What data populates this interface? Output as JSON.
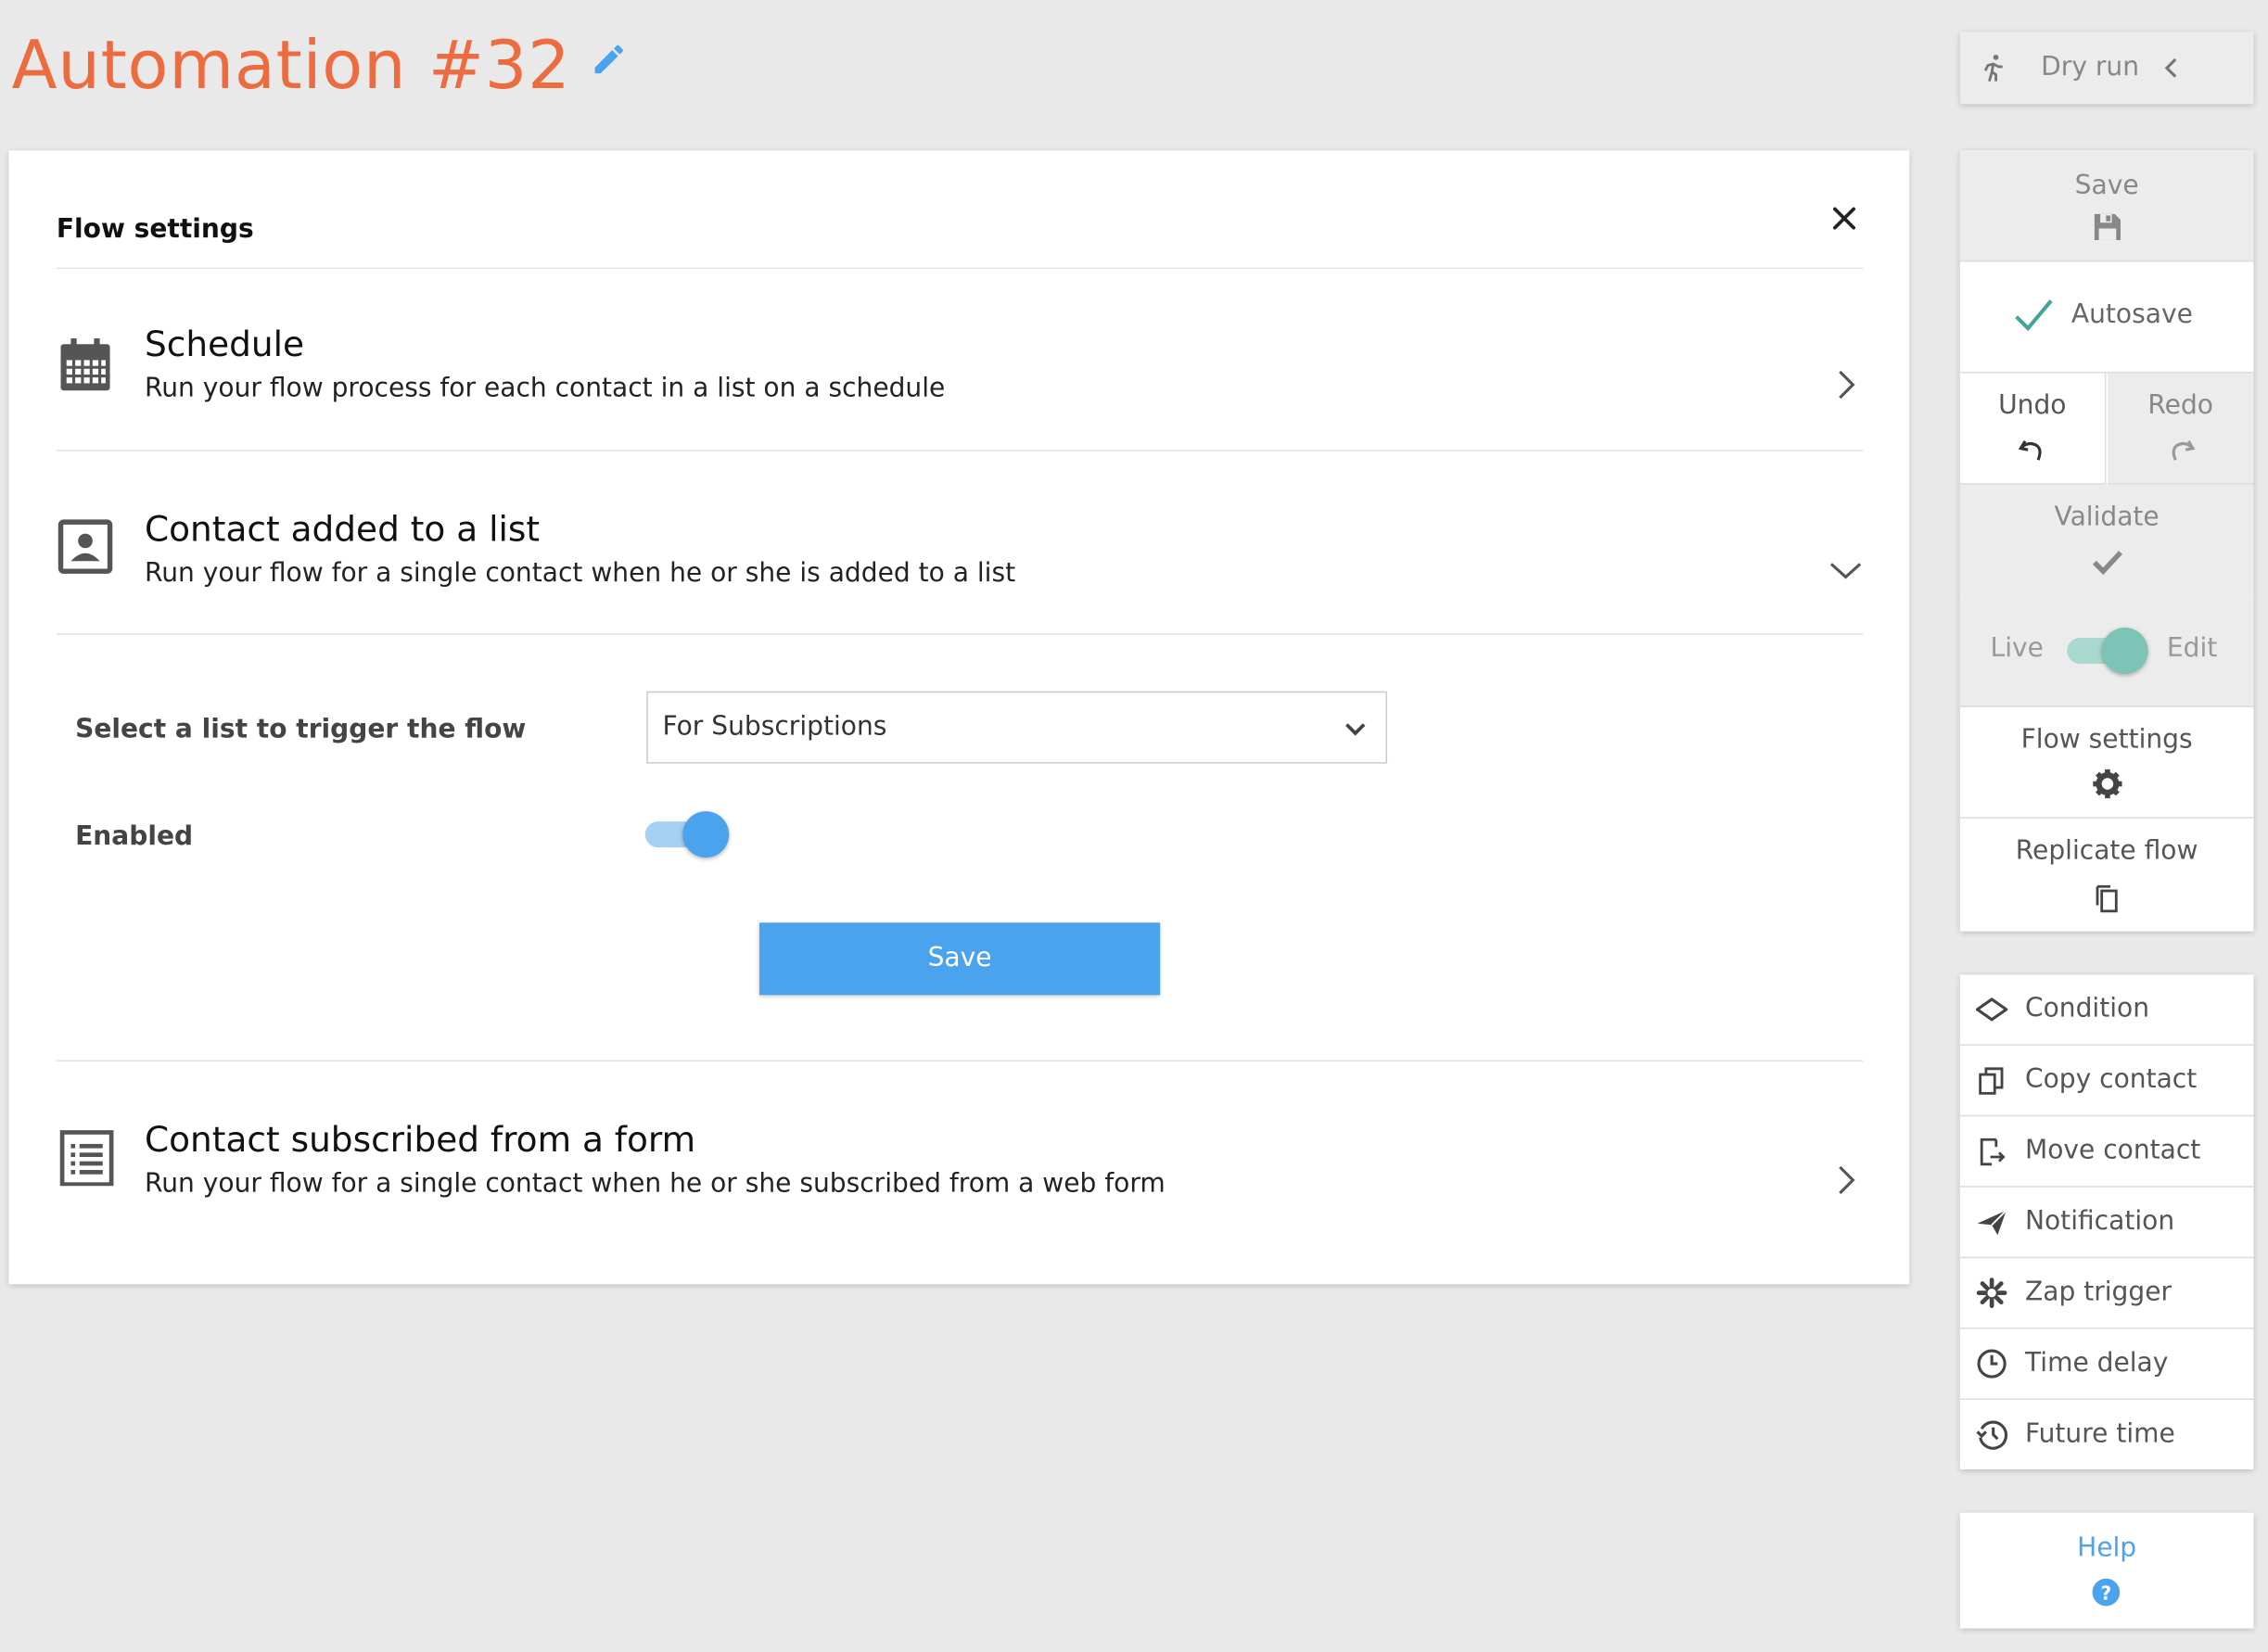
{
  "page": {
    "title": "Automation #32"
  },
  "modal": {
    "title": "Flow settings",
    "options": [
      {
        "title": "Schedule",
        "description": "Run your flow process for each contact in a list on a schedule",
        "icon": "calendar-icon",
        "state": "collapsed"
      },
      {
        "title": "Contact added to a list",
        "description": "Run your flow for a single contact when he or she is added to a list",
        "icon": "contact-card-icon",
        "state": "expanded"
      },
      {
        "title": "Contact subscribed from a form",
        "description": "Run your flow for a single contact when he or she subscribed from a web form",
        "icon": "form-icon",
        "state": "collapsed"
      }
    ],
    "list_field": {
      "label": "Select a list to trigger the flow",
      "value": "For Subscriptions"
    },
    "enabled_field": {
      "label": "Enabled",
      "checked": true
    },
    "save_label": "Save"
  },
  "toolbar": {
    "dry_run": "Dry run",
    "save": "Save",
    "autosave": "Autosave",
    "undo": "Undo",
    "redo": "Redo",
    "validate": "Validate",
    "live": "Live",
    "edit": "Edit",
    "flow_settings": "Flow settings",
    "replicate_flow": "Replicate flow"
  },
  "actions": [
    {
      "label": "Condition",
      "icon": "diamond-icon"
    },
    {
      "label": "Copy contact",
      "icon": "copy-icon"
    },
    {
      "label": "Move contact",
      "icon": "move-icon"
    },
    {
      "label": "Notification",
      "icon": "paper-plane-icon"
    },
    {
      "label": "Zap trigger",
      "icon": "zap-icon"
    },
    {
      "label": "Time delay",
      "icon": "clock-icon"
    },
    {
      "label": "Future time",
      "icon": "history-icon"
    }
  ],
  "help": {
    "label": "Help"
  },
  "colors": {
    "title": "#ec6b3f",
    "accent_blue": "#4ba3ee",
    "accent_teal": "#3fa597"
  }
}
